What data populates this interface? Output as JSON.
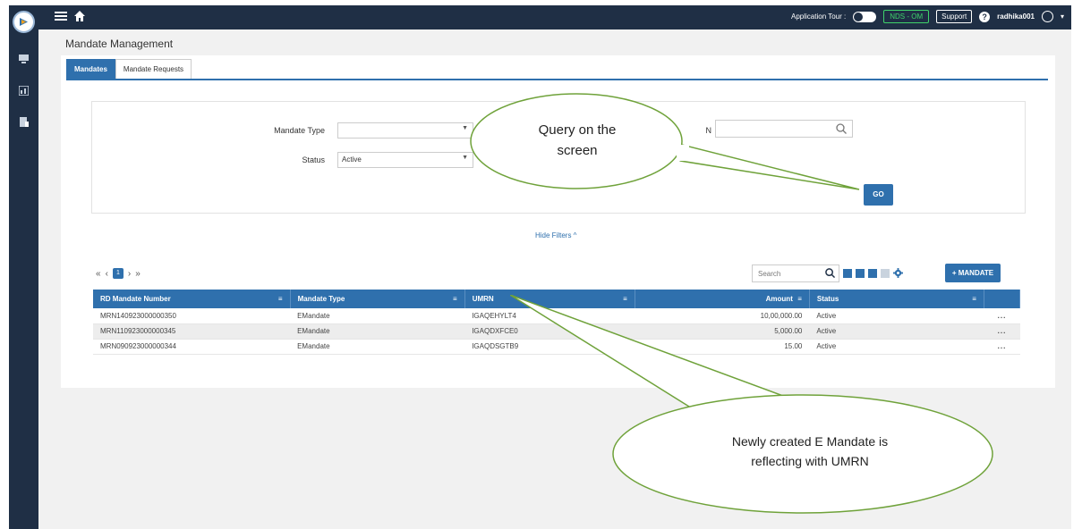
{
  "topbar": {
    "app_tour_label": "Application Tour :",
    "env_tag": "NDS - OM",
    "support_label": "Support",
    "help_symbol": "?",
    "username": "radhika001"
  },
  "page_title": "Mandate Management",
  "tabs": [
    {
      "label": "Mandates",
      "active": true
    },
    {
      "label": "Mandate Requests",
      "active": false
    }
  ],
  "filters": {
    "mandate_type_label": "Mandate Type",
    "mandate_type_value": "",
    "status_label": "Status",
    "status_value": "Active",
    "partial_label": "N",
    "go_label": "GO",
    "hide_filters_label": "Hide Filters ^"
  },
  "pager": {
    "first": "«",
    "prev": "‹",
    "current": "1",
    "next": "›",
    "last": "»"
  },
  "toolbar": {
    "search_placeholder": "Search",
    "add_label": "+ MANDATE"
  },
  "table": {
    "columns": [
      "RD Mandate Number",
      "Mandate Type",
      "UMRN",
      "Amount",
      "Status"
    ],
    "rows": [
      {
        "number": "MRN140923000000350",
        "type": "EMandate",
        "umrn": "IGAQEHYLT4",
        "amount": "10,00,000.00",
        "status": "Active"
      },
      {
        "number": "MRN110923000000345",
        "type": "EMandate",
        "umrn": "IGAQDXFCE0",
        "amount": "5,000.00",
        "status": "Active"
      },
      {
        "number": "MRN090923000000344",
        "type": "EMandate",
        "umrn": "IGAQDSGTB9",
        "amount": "15.00",
        "status": "Active"
      }
    ],
    "row_action": "..."
  },
  "callouts": {
    "query": [
      "Query on the",
      "screen"
    ],
    "umrn": [
      "Newly created E Mandate is",
      "reflecting with UMRN"
    ]
  },
  "colors": {
    "primary": "#2f70ad",
    "header_bg": "#1f2f45",
    "callout_border": "#6fa23a",
    "env_green": "#3fd36b"
  },
  "icons": [
    "home-icon",
    "menu-icon",
    "search-icon",
    "settings-icon",
    "user-avatar-icon"
  ]
}
